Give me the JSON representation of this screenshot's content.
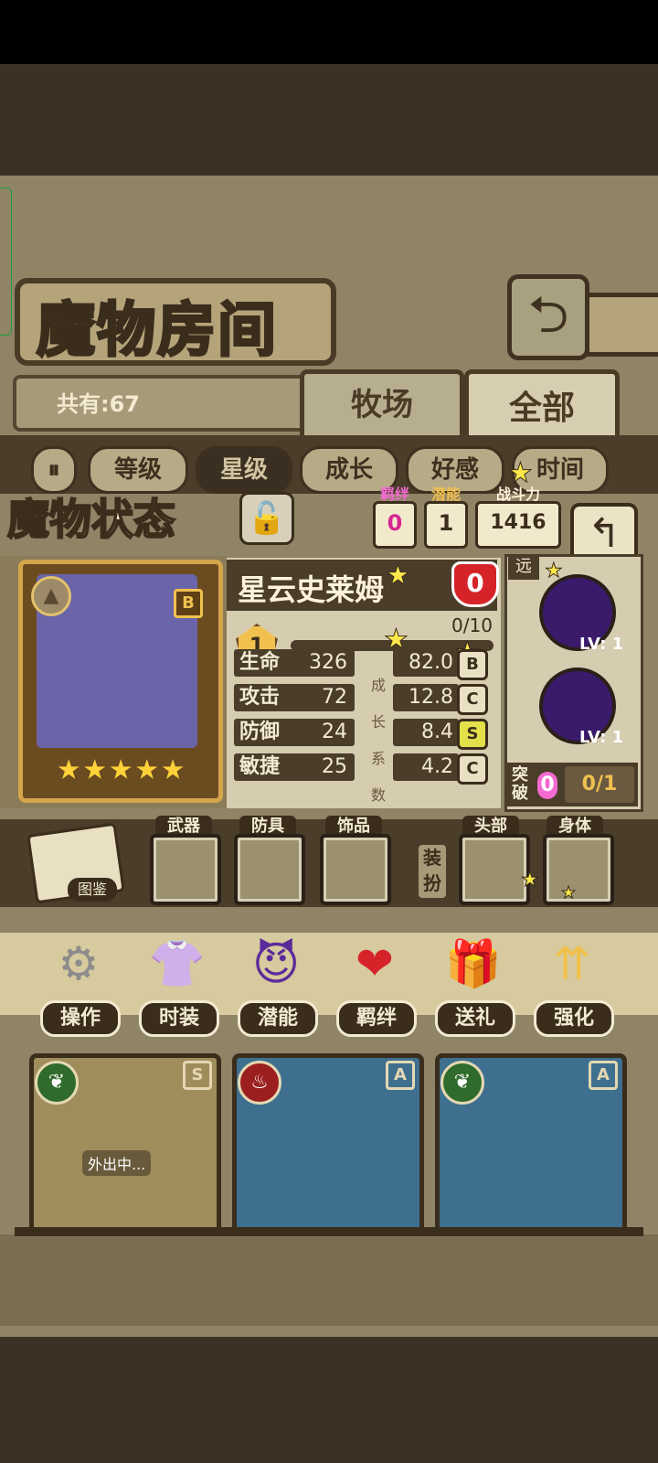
{
  "room": {
    "title": "魔物房间",
    "count_text": "共有:67",
    "tabs": [
      "牧场",
      "全部"
    ],
    "back_icon": "back-arrow-icon"
  },
  "sort": {
    "toggle_icon": "sort-toggle-icon",
    "options": [
      "等级",
      "星级",
      "成长",
      "好感",
      "时间"
    ],
    "active": "星级"
  },
  "status": {
    "title": "魔物状态",
    "lock_icon": "padlock-icon",
    "bond": {
      "label": "羁绊",
      "value": "0"
    },
    "potential": {
      "label": "潜能",
      "value": "1"
    },
    "power": {
      "label": "战斗力",
      "value": "1416"
    }
  },
  "monster": {
    "name": "星云史莱姆",
    "gem_count": "0",
    "rank": "B",
    "level": "1",
    "xp": "0/10",
    "xp_fraction": 0,
    "stars": "★★★★★",
    "stats": [
      {
        "label": "生命",
        "value": "326",
        "growth": "82.0",
        "grade": "B"
      },
      {
        "label": "攻击",
        "value": "72",
        "growth": "12.8",
        "grade": "C"
      },
      {
        "label": "防御",
        "value": "24",
        "growth": "8.4",
        "grade": "S"
      },
      {
        "label": "敏捷",
        "value": "25",
        "growth": "4.2",
        "grade": "C"
      }
    ],
    "growth_label": [
      "成",
      "长",
      "系",
      "数"
    ]
  },
  "skills": {
    "tag": "远",
    "items": [
      {
        "lv": "LV: 1"
      },
      {
        "lv": "LV: 1"
      }
    ],
    "breakthrough": {
      "label": "突破",
      "badge": "0",
      "count": "0/1"
    }
  },
  "equipment": {
    "book_label": "图鉴",
    "slots": [
      "武器",
      "防具",
      "饰品",
      "头部",
      "身体"
    ],
    "dress_label": "装扮"
  },
  "actions": [
    {
      "label": "操作",
      "icon": "gear-icon"
    },
    {
      "label": "时装",
      "icon": "outfit-icon"
    },
    {
      "label": "潜能",
      "icon": "demon-icon"
    },
    {
      "label": "羁绊",
      "icon": "hearts-icon"
    },
    {
      "label": "送礼",
      "icon": "gift-icon"
    },
    {
      "label": "强化",
      "icon": "upgrade-arrows-icon"
    }
  ],
  "monster_list": [
    {
      "rank": "S",
      "element": "leaf-icon",
      "status": "外出中..."
    },
    {
      "rank": "A",
      "element": "fire-icon",
      "status": ""
    },
    {
      "rank": "A",
      "element": "leaf-icon",
      "status": ""
    }
  ],
  "colors": {
    "accent": "#f1c14f",
    "panel_dark": "#4a3d2a",
    "paper": "#d6ccb0"
  }
}
